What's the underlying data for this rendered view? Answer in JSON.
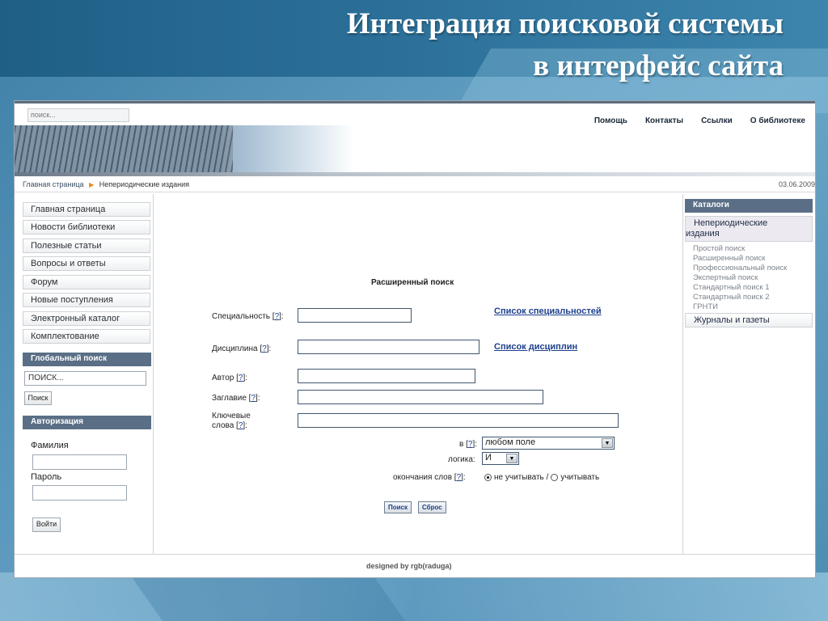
{
  "slide": {
    "title_line1": "Интеграция поисковой системы",
    "title_line2": "в интерфейс сайта"
  },
  "site": {
    "top_search_placeholder": "поиск...",
    "nav": [
      "Помощь",
      "Контакты",
      "Ссылки",
      "О библиотеке"
    ],
    "breadcrumb": {
      "home": "Главная страница",
      "current": "Непериодические издания",
      "date": "03.06.2009"
    },
    "menu": [
      "Главная страница",
      "Новости библиотеки",
      "Полезные статьи",
      "Вопросы и ответы",
      "Форум",
      "Новые поступления",
      "Электронный каталог",
      "Комплектование"
    ],
    "global_search": {
      "heading": "Глобальный поиск",
      "value": "ПОИСК...",
      "button": "Поиск"
    },
    "auth": {
      "heading": "Авторизация",
      "surname_label": "Фамилия",
      "password_label": "Пароль",
      "login_button": "Войти"
    },
    "form": {
      "title": "Расширенный поиск",
      "help": "?",
      "specialty_label": "Специальность",
      "specialty_link": "Список специальностей",
      "discipline_label": "Дисциплина",
      "discipline_link": "Список дисциплин",
      "author_label": "Автор",
      "title_label": "Заглавие",
      "keywords_label_1": "Ключевые",
      "keywords_label_2": "слова",
      "in_label": "в",
      "in_value": "любом поле",
      "logic_label": "логика:",
      "logic_value": "И",
      "endings_label": "окончания слов",
      "radio_ignore": "не учитывать /",
      "radio_consider": "учитывать",
      "search_button": "Поиск",
      "reset_button": "Сброс"
    },
    "catalogs": {
      "heading": "Каталоги",
      "active_line1": "Непериодические",
      "active_line2": "издания",
      "links": [
        "Простой поиск",
        "Расширенный поиск",
        "Профессиональный поиск",
        "Экспертный поиск",
        "Стандартный поиск 1",
        "Стандартный поиск 2",
        "ГРНТИ"
      ],
      "journals": "Журналы и газеты"
    },
    "footer": "designed by rgb(raduga)"
  },
  "colors": {
    "panel_header": "#5a6f86",
    "link_blue": "#1d3f8c",
    "breadcrumb_arrow": "#e38b1b"
  }
}
